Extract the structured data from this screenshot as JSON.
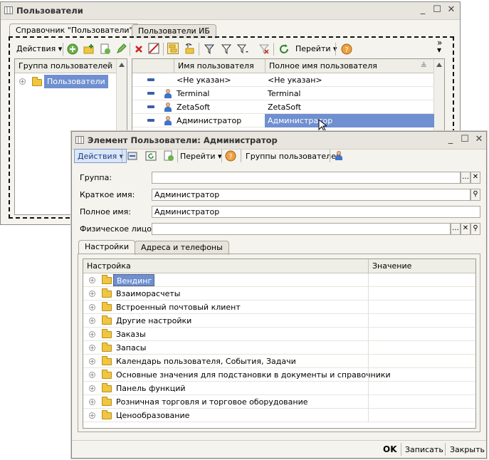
{
  "back": {
    "title": "Пользователи",
    "tabs": [
      "Справочник \"Пользователи\"",
      "Пользователи ИБ"
    ],
    "toolbar": {
      "actions": "Действия",
      "goto": "Перейти",
      "more": "»"
    },
    "left_header": "Группа пользователей",
    "tree_item": "Пользователи",
    "columns": [
      "Имя пользователя",
      "Полное имя пользователя"
    ],
    "rows": [
      {
        "name": "<Не указан>",
        "full": "<Не указан>"
      },
      {
        "name": "Terminal",
        "full": "Terminal"
      },
      {
        "name": "ZetaSoft",
        "full": "ZetaSoft"
      },
      {
        "name": "Администратор",
        "full": "Администратор"
      }
    ]
  },
  "front": {
    "title": "Элемент Пользователи: Администратор",
    "toolbar": {
      "actions": "Действия",
      "goto": "Перейти",
      "groups": "Группы пользователей"
    },
    "fields": {
      "group_label": "Группа:",
      "group_value": "",
      "short_label": "Краткое имя:",
      "short_value": "Администратор",
      "full_label": "Полное имя:",
      "full_value": "Администратор",
      "person_label": "Физическое лицо:",
      "person_value": ""
    },
    "tabs": [
      "Настройки",
      "Адреса и телефоны"
    ],
    "settings_header": {
      "setting": "Настройка",
      "value": "Значение"
    },
    "settings": [
      "Вендинг",
      "Взаиморасчеты",
      "Встроенный почтовый клиент",
      "Другие настройки",
      "Заказы",
      "Запасы",
      "Календарь пользователя, События, Задачи",
      "Основные значения для подстановки в документы и справочники",
      "Панель функций",
      "Розничная торговля и торговое оборудование",
      "Ценообразование"
    ],
    "footer": {
      "ok": "OK",
      "save": "Записать",
      "close": "Закрыть"
    }
  }
}
